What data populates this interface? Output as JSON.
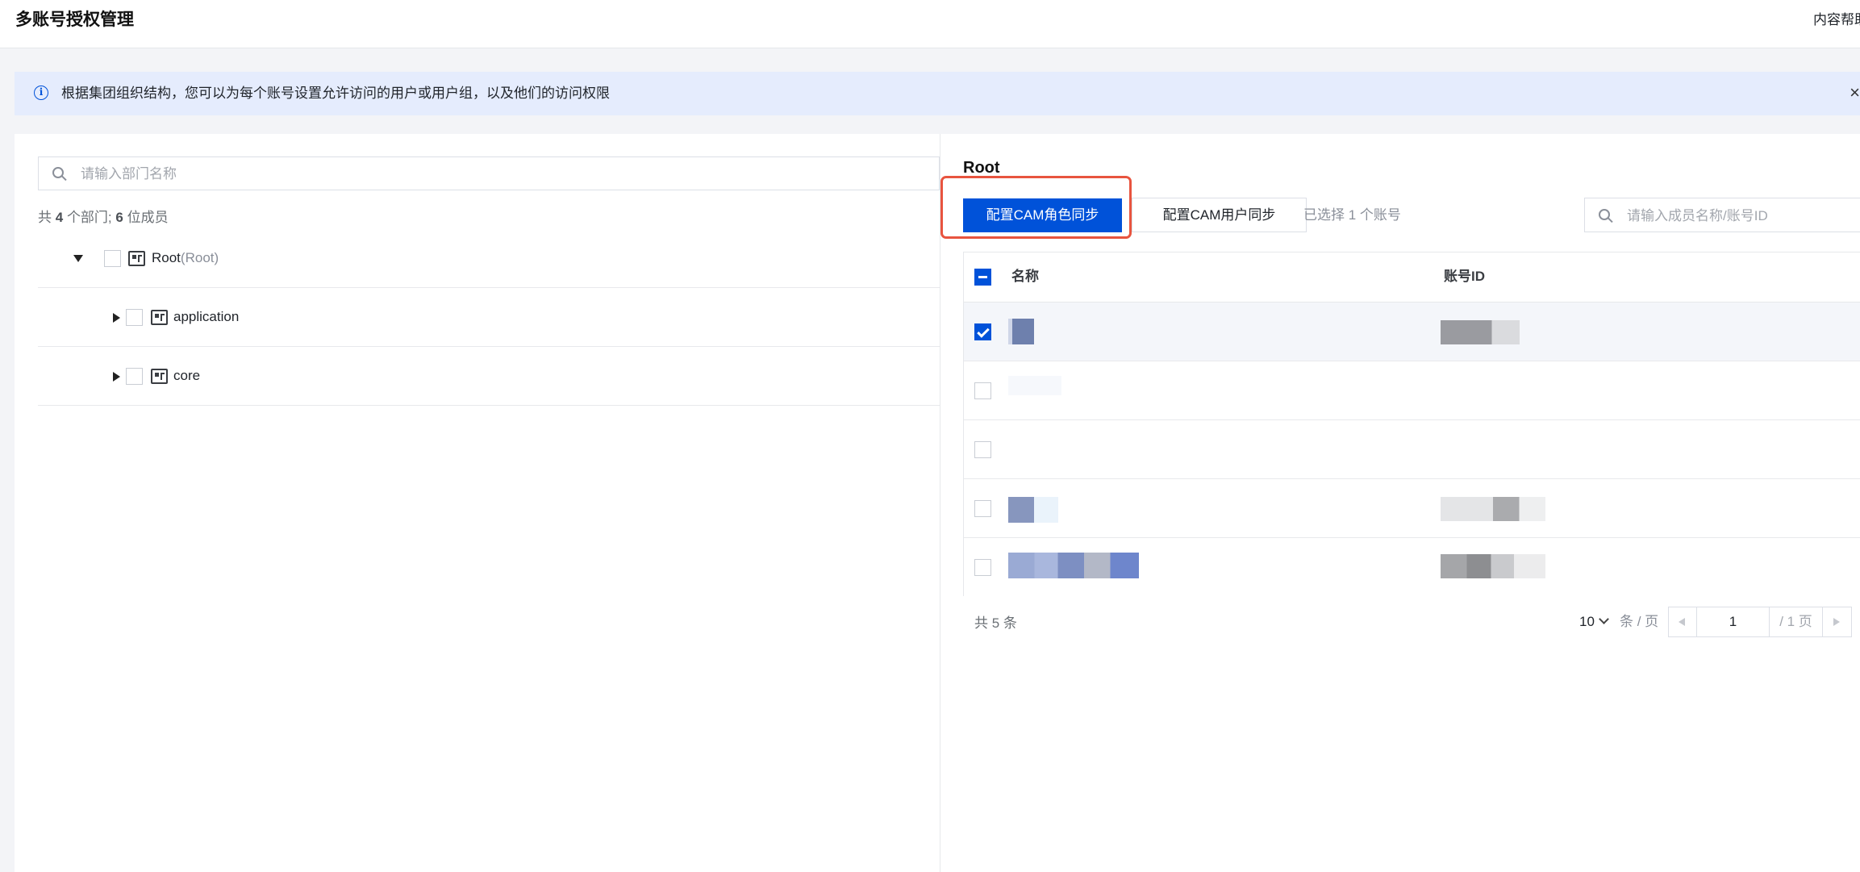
{
  "header": {
    "title": "多账号授权管理",
    "help_link": "内容帮助"
  },
  "notice": {
    "text": "根据集团组织结构，您可以为每个账号设置允许访问的用户或用户组，以及他们的访问权限",
    "close": "×",
    "icon": "info-icon"
  },
  "departments": {
    "search_placeholder": "请输入部门名称",
    "summary": {
      "prefix": "共",
      "dept_count": "4",
      "dept_unit": "个部门;",
      "member_count": "6",
      "member_unit": "位成员"
    },
    "tree": [
      {
        "name": "Root",
        "sub": "(Root)",
        "expanded": true,
        "level": 0
      },
      {
        "name": "application",
        "expanded": false,
        "level": 1
      },
      {
        "name": "core",
        "expanded": false,
        "level": 1
      }
    ]
  },
  "detail": {
    "title": "Root",
    "buttons": {
      "role_sync": "配置CAM角色同步",
      "user_sync": "配置CAM用户同步"
    },
    "selected_info": "已选择 1 个账号",
    "search_placeholder": "请输入成员名称/账号ID",
    "table": {
      "columns": [
        "名称",
        "账号ID"
      ],
      "rows": [
        {
          "checked": true
        },
        {
          "checked": false
        },
        {
          "checked": false
        },
        {
          "checked": false
        },
        {
          "checked": false
        }
      ]
    },
    "total": "共 5 条",
    "pagination": {
      "page_size": "10",
      "per_page_label": "条 / 页",
      "current_page": "1",
      "total_pages": "/ 1 页"
    }
  },
  "colors": {
    "primary": "#0052d9",
    "highlight": "#e8543f",
    "notice_bg": "#e5ecfd"
  }
}
